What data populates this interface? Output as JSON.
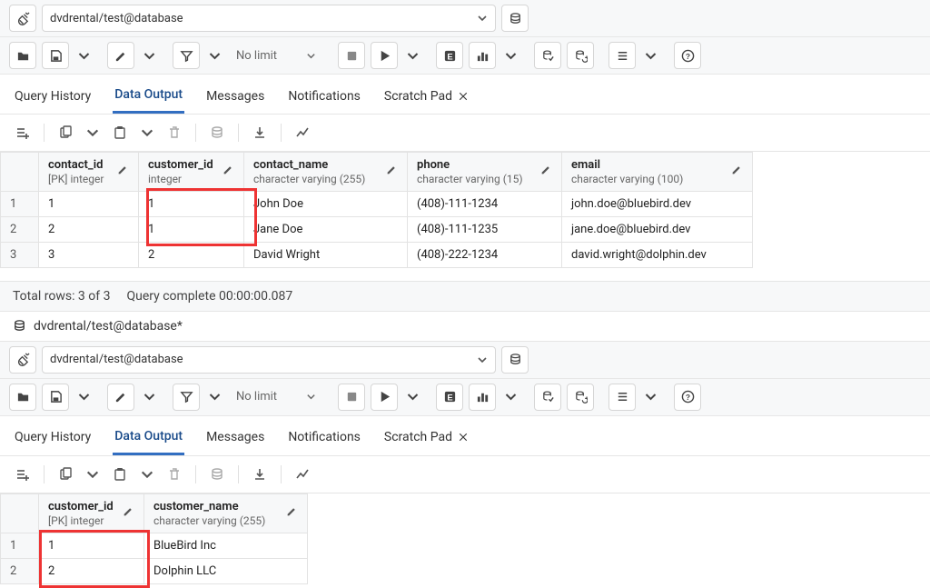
{
  "instance1": {
    "connection": "dvdrental/test@database",
    "limit_label": "No limit",
    "tabs": {
      "query_history": "Query History",
      "data_output": "Data Output",
      "messages": "Messages",
      "notifications": "Notifications",
      "scratch_pad": "Scratch Pad"
    },
    "columns": [
      {
        "name": "contact_id",
        "type": "[PK] integer"
      },
      {
        "name": "customer_id",
        "type": "integer"
      },
      {
        "name": "contact_name",
        "type": "character varying (255)"
      },
      {
        "name": "phone",
        "type": "character varying (15)"
      },
      {
        "name": "email",
        "type": "character varying (100)"
      }
    ],
    "rows": [
      {
        "n": "1",
        "contact_id": "1",
        "customer_id": "1",
        "contact_name": "John Doe",
        "phone": "(408)-111-1234",
        "email": "john.doe@bluebird.dev"
      },
      {
        "n": "2",
        "contact_id": "2",
        "customer_id": "1",
        "contact_name": "Jane Doe",
        "phone": "(408)-111-1235",
        "email": "jane.doe@bluebird.dev"
      },
      {
        "n": "3",
        "contact_id": "3",
        "customer_id": "2",
        "contact_name": "David Wright",
        "phone": "(408)-222-1234",
        "email": "david.wright@dolphin.dev"
      }
    ],
    "status": {
      "total_rows": "Total rows: 3 of 3",
      "query_complete": "Query complete 00:00:00.087"
    },
    "title_mod": "dvdrental/test@database*"
  },
  "instance2": {
    "connection": "dvdrental/test@database",
    "limit_label": "No limit",
    "tabs": {
      "query_history": "Query History",
      "data_output": "Data Output",
      "messages": "Messages",
      "notifications": "Notifications",
      "scratch_pad": "Scratch Pad"
    },
    "columns": [
      {
        "name": "customer_id",
        "type": "[PK] integer"
      },
      {
        "name": "customer_name",
        "type": "character varying (255)"
      }
    ],
    "rows": [
      {
        "n": "1",
        "customer_id": "1",
        "customer_name": "BlueBird Inc"
      },
      {
        "n": "2",
        "customer_id": "2",
        "customer_name": "Dolphin LLC"
      }
    ]
  }
}
